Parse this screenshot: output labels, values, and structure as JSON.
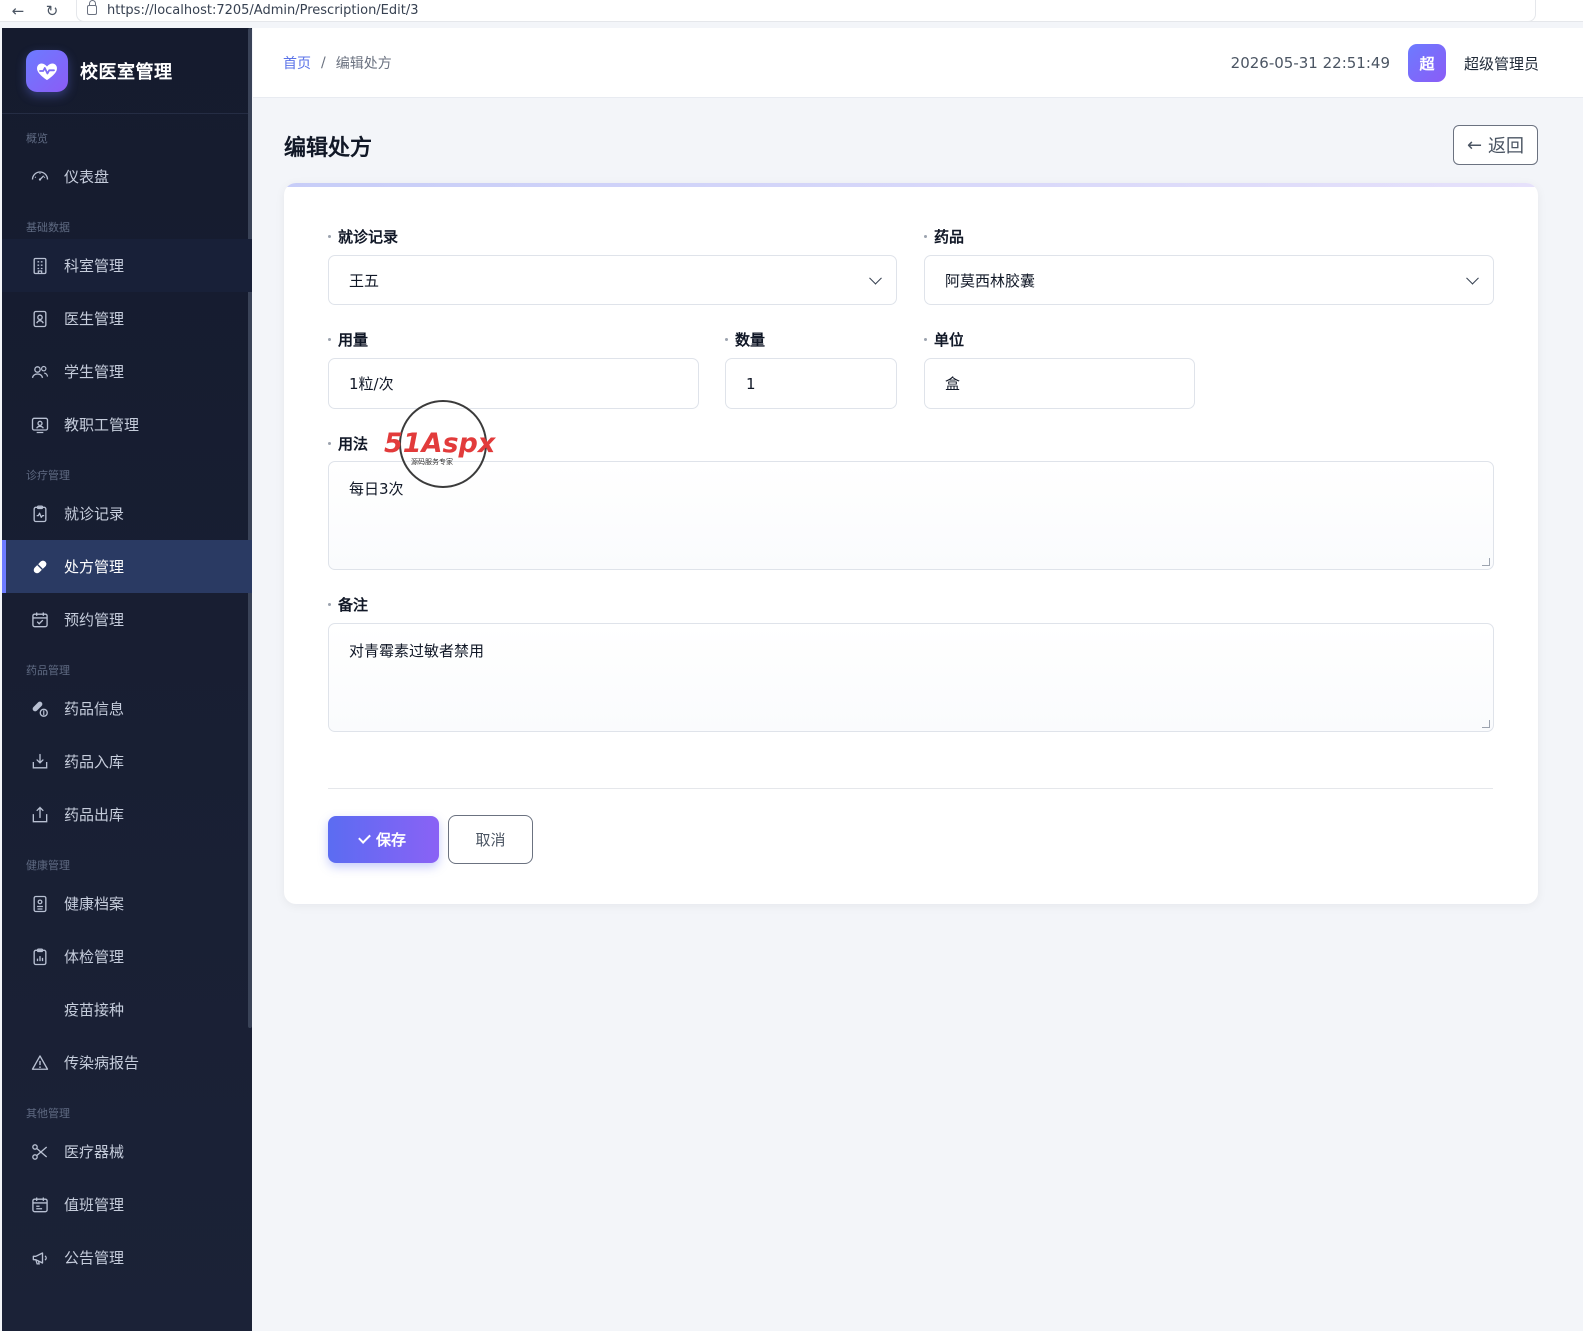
{
  "browser": {
    "url": "https://localhost:7205/Admin/Prescription/Edit/3"
  },
  "brand": {
    "title": "校医室管理"
  },
  "sidebar": {
    "sections": [
      {
        "title": "概览",
        "items": [
          {
            "label": "仪表盘",
            "icon": "gauge-icon"
          }
        ]
      },
      {
        "title": "基础数据",
        "items": [
          {
            "label": "科室管理",
            "icon": "building-icon"
          },
          {
            "label": "医生管理",
            "icon": "badge-icon"
          },
          {
            "label": "学生管理",
            "icon": "users-icon"
          },
          {
            "label": "教职工管理",
            "icon": "person-card-icon"
          }
        ]
      },
      {
        "title": "诊疗管理",
        "items": [
          {
            "label": "就诊记录",
            "icon": "clipboard-pulse-icon"
          },
          {
            "label": "处方管理",
            "icon": "capsule-icon",
            "active": true
          },
          {
            "label": "预约管理",
            "icon": "calendar-check-icon"
          }
        ]
      },
      {
        "title": "药品管理",
        "items": [
          {
            "label": "药品信息",
            "icon": "pills-icon"
          },
          {
            "label": "药品入库",
            "icon": "box-in-icon"
          },
          {
            "label": "药品出库",
            "icon": "box-out-icon"
          }
        ]
      },
      {
        "title": "健康管理",
        "items": [
          {
            "label": "健康档案",
            "icon": "file-person-icon"
          },
          {
            "label": "体检管理",
            "icon": "clipboard-chart-icon"
          },
          {
            "label": "疫苗接种",
            "icon": ""
          },
          {
            "label": "传染病报告",
            "icon": "warning-icon"
          }
        ]
      },
      {
        "title": "其他管理",
        "items": [
          {
            "label": "医疗器械",
            "icon": "scissors-icon"
          },
          {
            "label": "值班管理",
            "icon": "calendar-icon"
          },
          {
            "label": "公告管理",
            "icon": "megaphone-icon"
          }
        ]
      }
    ]
  },
  "header": {
    "breadcrumb_home": "首页",
    "breadcrumb_sep": "/",
    "breadcrumb_current": "编辑处方",
    "datetime": "2026-05-31 22:51:49",
    "avatar_text": "超",
    "username": "超级管理员"
  },
  "page": {
    "title": "编辑处方",
    "back_label": "返回",
    "back_arrow": "←"
  },
  "form": {
    "visit_label": "就诊记录",
    "visit_value": "王五",
    "drug_label": "药品",
    "drug_value": "阿莫西林胶囊",
    "dosage_label": "用量",
    "dosage_value": "1粒/次",
    "quantity_label": "数量",
    "quantity_value": "1",
    "unit_label": "单位",
    "unit_value": "盒",
    "usage_label": "用法",
    "usage_value": "每日3次",
    "remark_label": "备注",
    "remark_value": "对青霉素过敏者禁用",
    "save_label": "保存",
    "cancel_label": "取消"
  },
  "watermark": {
    "brand": "51Aspx",
    "sub": "源码服务专家"
  },
  "colors": {
    "accent": "#6c7bff",
    "sidebar_bg": "#151b2e",
    "active_bg": "#2a3a63"
  }
}
